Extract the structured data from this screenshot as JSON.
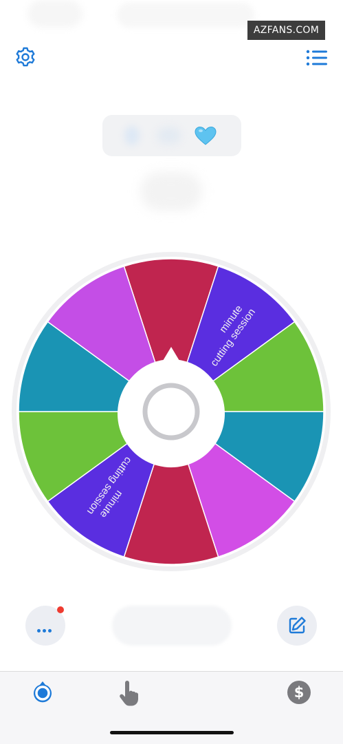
{
  "watermark": "AZFANS.COM",
  "colors": {
    "accent": "#1e7ad8",
    "red_dot": "#ee3b30",
    "heart": "#5ec3f0",
    "segments": [
      "#c0254f",
      "#5a2ee0",
      "#6dc23a",
      "#1a94b4",
      "#d24ee6",
      "#c0254f",
      "#5a2ee0",
      "#6dc23a",
      "#1a94b4",
      "#c44ee6"
    ]
  },
  "wheel": {
    "segment_count": 10,
    "labels": [
      {
        "line1": "minute",
        "line2": "cutting session"
      },
      {
        "line1": "minute",
        "line2": "cutting session"
      }
    ],
    "center_indicator": "ring"
  },
  "icons": {
    "settings": "gear-icon",
    "list": "list-icon",
    "heart": "heart-icon",
    "more": "more-dots-icon",
    "edit": "edit-icon",
    "wheel_tab": "wheel-icon",
    "tap_tab": "hand-tap-icon",
    "pro_tab": "dollar-icon"
  }
}
